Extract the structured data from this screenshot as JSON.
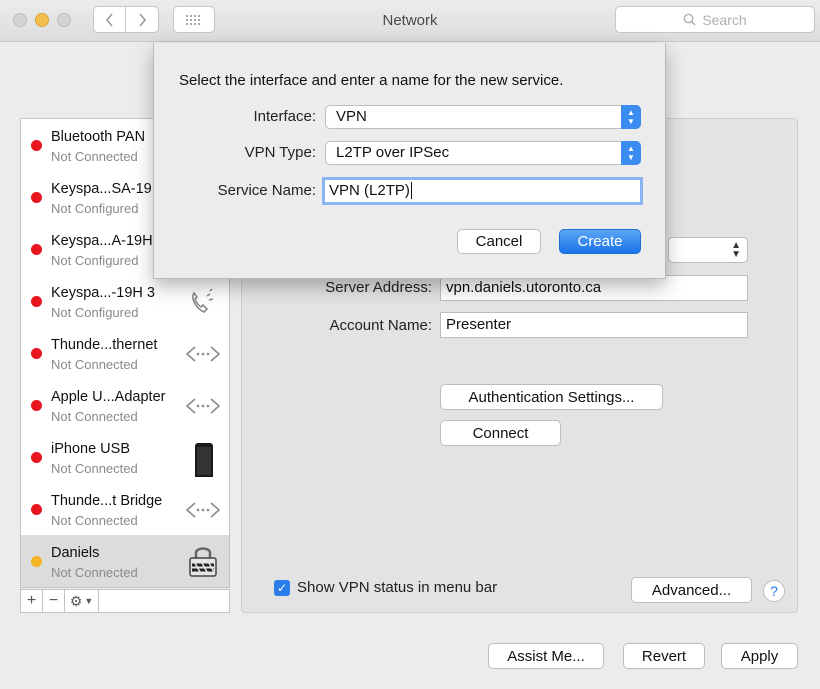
{
  "window": {
    "title": "Network",
    "search_placeholder": "Search"
  },
  "services": [
    {
      "name": "Bluetooth PAN",
      "status": "Not Connected",
      "dot": "red",
      "icon": "none"
    },
    {
      "name": "Keyspa...SA-19",
      "status": "Not Configured",
      "dot": "red",
      "icon": "none"
    },
    {
      "name": "Keyspa...A-19H",
      "status": "Not Configured",
      "dot": "red",
      "icon": "none"
    },
    {
      "name": "Keyspa...-19H 3",
      "status": "Not Configured",
      "dot": "red",
      "icon": "phone-icon"
    },
    {
      "name": "Thunde...thernet",
      "status": "Not Connected",
      "dot": "red",
      "icon": "ethernet-icon"
    },
    {
      "name": "Apple U...Adapter",
      "status": "Not Connected",
      "dot": "red",
      "icon": "ethernet-icon"
    },
    {
      "name": "iPhone USB",
      "status": "Not Connected",
      "dot": "red",
      "icon": "iphone-icon"
    },
    {
      "name": "Thunde...t Bridge",
      "status": "Not Connected",
      "dot": "red",
      "icon": "ethernet-icon"
    },
    {
      "name": "Daniels",
      "status": "Not Connected",
      "dot": "yellow",
      "icon": "vpn-lock-icon",
      "selected": true
    }
  ],
  "sidebar_tools": {
    "add": "+",
    "remove": "−",
    "gear": "⚙"
  },
  "detail": {
    "server_address_label": "Server Address:",
    "server_address_value": "vpn.daniels.utoronto.ca",
    "account_name_label": "Account Name:",
    "account_name_value": "Presenter",
    "auth_settings_button": "Authentication Settings...",
    "connect_button": "Connect",
    "show_vpn_status_label": "Show VPN status in menu bar",
    "show_vpn_status_checked": true,
    "advanced_button": "Advanced...",
    "help_button": "?"
  },
  "footer": {
    "assist_button": "Assist Me...",
    "revert_button": "Revert",
    "apply_button": "Apply"
  },
  "sheet": {
    "prompt": "Select the interface and enter a name for the new service.",
    "interface_label": "Interface:",
    "interface_value": "VPN",
    "vpn_type_label": "VPN Type:",
    "vpn_type_value": "L2TP over IPSec",
    "service_name_label": "Service Name:",
    "service_name_value": "VPN (L2TP)",
    "cancel_button": "Cancel",
    "create_button": "Create"
  },
  "colors": {
    "accent": "#2b7de9",
    "status_red": "#e8141e",
    "status_yellow": "#f5b324"
  }
}
